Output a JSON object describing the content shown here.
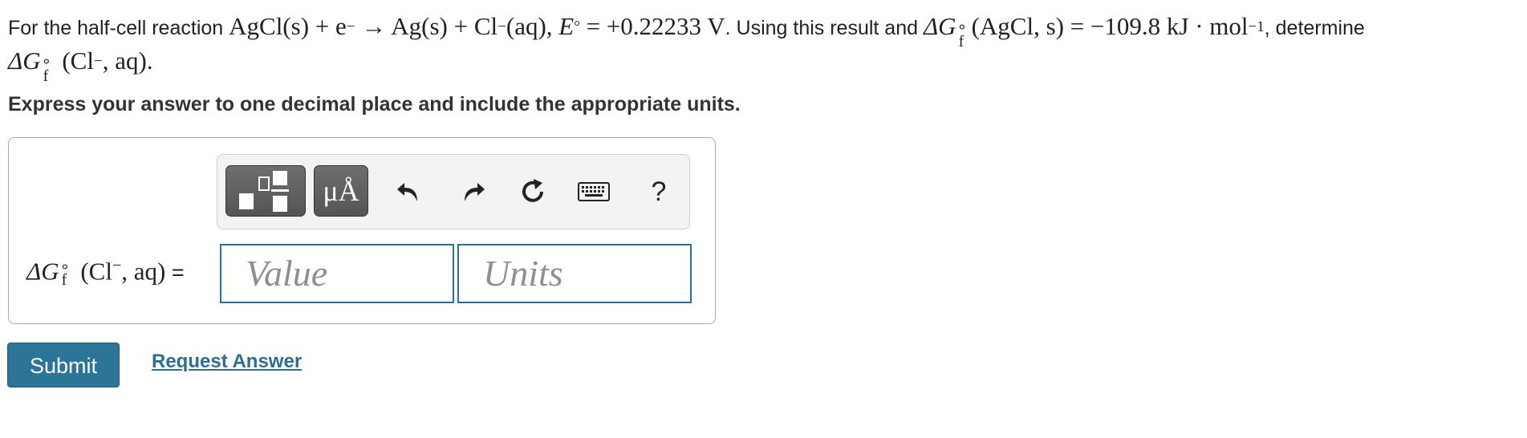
{
  "question": {
    "t1": "For the half-cell reaction ",
    "reaction": "AgCl(s) + e",
    "e_charge": "−",
    "arrow_part": " → Ag(s) + Cl",
    "cl_charge": "−",
    "aq_part": "(aq),  ",
    "E_symbol": "E",
    "deg": "°",
    "E_value": " = +0.22233 V",
    "t2": ". Using this result and ",
    "dG": "ΔG",
    "deg_sup": "∘",
    "f_sub": "f",
    "agcl_part": "(AgCl,  s) = −109.8 kJ · mol",
    "mol_exp": "−1",
    "t3": ", determine",
    "dG2": "ΔG",
    "deg_sup2": "∘",
    "f_sub2": "f",
    "cl_part": " (Cl",
    "cl_charge2": "−",
    "cl_end": ", aq)",
    "period": "."
  },
  "instruction": "Express your answer to one decimal place and include the appropriate units.",
  "toolbar": {
    "units_label": "μÅ",
    "help": "?"
  },
  "answer_label": {
    "dG": "ΔG",
    "deg_sup": "∘",
    "f_sub": "f",
    "body": " (Cl",
    "charge": "−",
    "end": ", aq)",
    "eq": " ="
  },
  "inputs": {
    "value_placeholder": "Value",
    "units_placeholder": "Units"
  },
  "buttons": {
    "submit": "Submit",
    "request_answer": "Request Answer"
  }
}
